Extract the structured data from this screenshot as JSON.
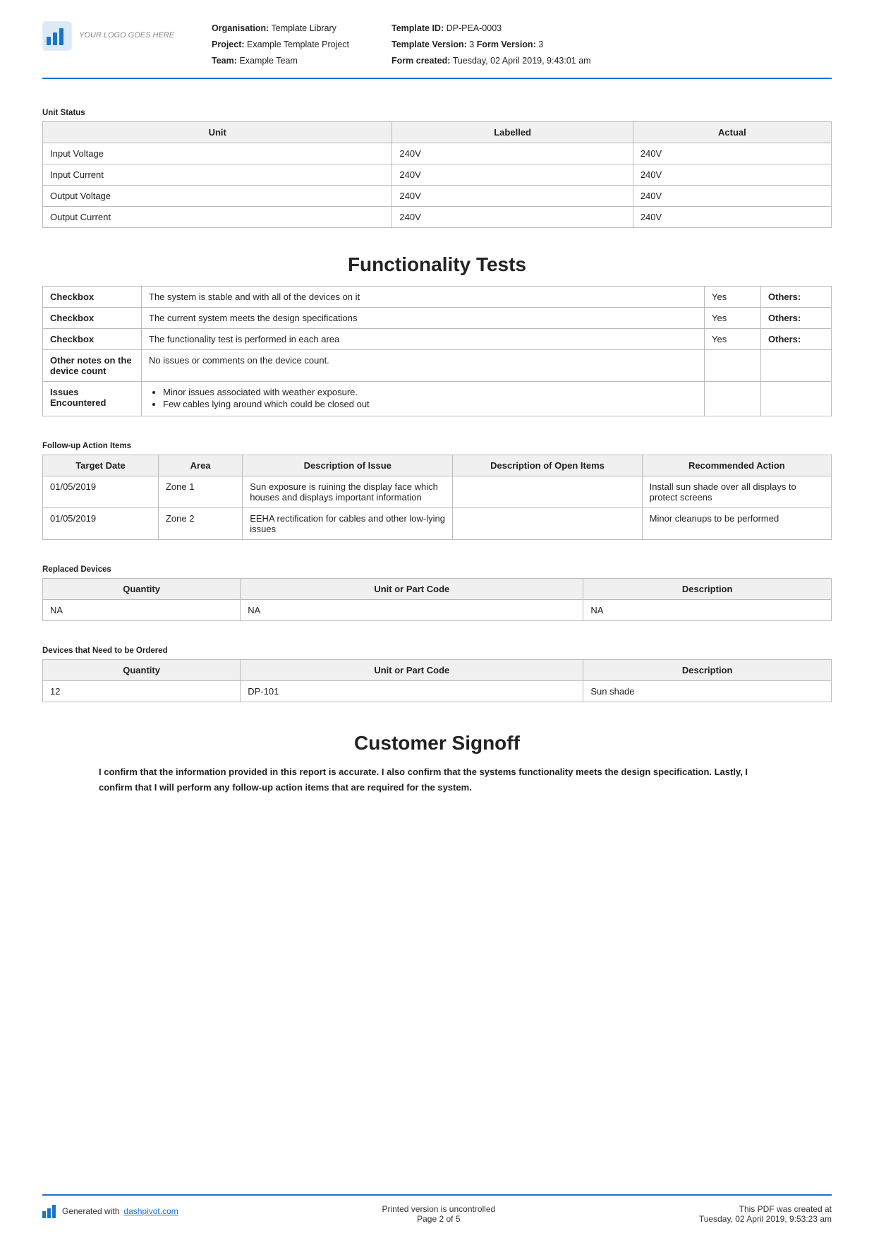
{
  "header": {
    "logo_text": "YOUR LOGO GOES HERE",
    "org_label": "Organisation:",
    "org_value": "Template Library",
    "project_label": "Project:",
    "project_value": "Example Template Project",
    "team_label": "Team:",
    "team_value": "Example Team",
    "template_id_label": "Template ID:",
    "template_id_value": "DP-PEA-0003",
    "template_version_label": "Template Version:",
    "template_version_value": "3",
    "form_version_label": "Form Version:",
    "form_version_value": "3",
    "form_created_label": "Form created:",
    "form_created_value": "Tuesday, 02 April 2019, 9:43:01 am"
  },
  "unit_status": {
    "section_title": "Unit Status",
    "columns": [
      "Unit",
      "Labelled",
      "Actual"
    ],
    "rows": [
      [
        "Input Voltage",
        "240V",
        "240V"
      ],
      [
        "Input Current",
        "240V",
        "240V"
      ],
      [
        "Output Voltage",
        "240V",
        "240V"
      ],
      [
        "Output Current",
        "240V",
        "240V"
      ]
    ]
  },
  "functionality_tests": {
    "heading": "Functionality Tests",
    "rows": [
      {
        "field_type": "Checkbox",
        "description": "The system is stable and with all of the devices on it",
        "value": "Yes",
        "others_label": "Others:"
      },
      {
        "field_type": "Checkbox",
        "description": "The current system meets the design specifications",
        "value": "Yes",
        "others_label": "Others:"
      },
      {
        "field_type": "Checkbox",
        "description": "The functionality test is performed in each area",
        "value": "Yes",
        "others_label": "Others:"
      },
      {
        "field_type": "Other notes on the device count",
        "description": "No issues or comments on the device count.",
        "value": "",
        "others_label": ""
      },
      {
        "field_type": "Issues Encountered",
        "bullets": [
          "Minor issues associated with weather exposure.",
          "Few cables lying around which could be closed out"
        ],
        "value": "",
        "others_label": ""
      }
    ]
  },
  "followup": {
    "section_title": "Follow-up Action Items",
    "columns": [
      "Target Date",
      "Area",
      "Description of Issue",
      "Description of Open Items",
      "Recommended Action"
    ],
    "rows": [
      {
        "target_date": "01/05/2019",
        "area": "Zone 1",
        "description_of_issue": "Sun exposure is ruining the display face which houses and displays important information",
        "description_of_open_items": "",
        "recommended_action": "Install sun shade over all displays to protect screens"
      },
      {
        "target_date": "01/05/2019",
        "area": "Zone 2",
        "description_of_issue": "EEHA rectification for cables and other low-lying issues",
        "description_of_open_items": "",
        "recommended_action": "Minor cleanups to be performed"
      }
    ]
  },
  "replaced_devices": {
    "section_title": "Replaced Devices",
    "columns": [
      "Quantity",
      "Unit or Part Code",
      "Description"
    ],
    "rows": [
      [
        "NA",
        "NA",
        "NA"
      ]
    ]
  },
  "devices_to_order": {
    "section_title": "Devices that Need to be Ordered",
    "columns": [
      "Quantity",
      "Unit or Part Code",
      "Description"
    ],
    "rows": [
      [
        "12",
        "DP-101",
        "Sun shade"
      ]
    ]
  },
  "customer_signoff": {
    "heading": "Customer Signoff",
    "text": "I confirm that the information provided in this report is accurate. I also confirm that the systems functionality meets the design specification. Lastly, I confirm that I will perform any follow-up action items that are required for the system."
  },
  "footer": {
    "generated_text": "Generated with",
    "dashpivot_link": "dashpivot.com",
    "center_line1": "Printed version is uncontrolled",
    "center_line2": "Page 2 of 5",
    "right_line1": "This PDF was created at",
    "right_line2": "Tuesday, 02 April 2019, 9:53:23 am"
  }
}
